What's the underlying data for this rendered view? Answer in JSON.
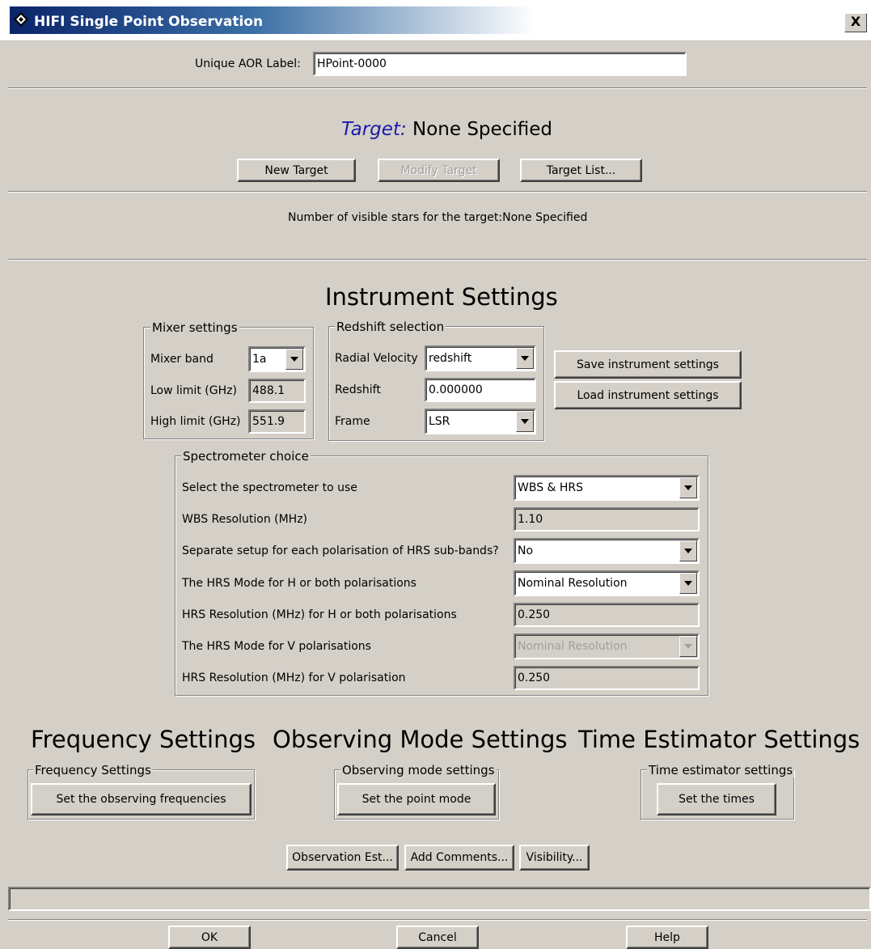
{
  "window": {
    "title": "HIFI Single Point Observation",
    "close_label": "X"
  },
  "aor": {
    "label": "Unique AOR Label:",
    "value": "HPoint-0000"
  },
  "target": {
    "prefix": "Target:",
    "value": "None Specified",
    "new_button": "New Target",
    "modify_button": "Modify Target",
    "list_button": "Target List...",
    "visible_stars": "Number of visible stars for the target:None Specified"
  },
  "instrument": {
    "heading": "Instrument Settings",
    "mixer": {
      "legend": "Mixer settings",
      "band_label": "Mixer band",
      "band_value": "1a",
      "low_label": "Low limit (GHz)",
      "low_value": "488.1",
      "high_label": "High limit (GHz)",
      "high_value": "551.9"
    },
    "redshift": {
      "legend": "Redshift selection",
      "velocity_label": "Radial Velocity",
      "velocity_value": "redshift",
      "redshift_label": "Redshift",
      "redshift_value": "0.000000",
      "frame_label": "Frame",
      "frame_value": "LSR"
    },
    "save_button": "Save instrument settings",
    "load_button": "Load instrument settings",
    "spectrometer": {
      "legend": "Spectrometer choice",
      "rows": [
        {
          "label": "Select the spectrometer to use",
          "value": "WBS & HRS"
        },
        {
          "label": "WBS Resolution (MHz)",
          "value": "1.10"
        },
        {
          "label": "Separate setup for each polarisation of HRS sub-bands?",
          "value": "No"
        },
        {
          "label": "The HRS Mode for H or both polarisations",
          "value": "Nominal Resolution"
        },
        {
          "label": "HRS Resolution (MHz) for H or both polarisations",
          "value": "0.250"
        },
        {
          "label": "The HRS Mode for V polarisations",
          "value": "Nominal Resolution"
        },
        {
          "label": "HRS Resolution (MHz) for V polarisation",
          "value": "0.250"
        }
      ]
    }
  },
  "frequency": {
    "heading": "Frequency Settings",
    "legend": "Frequency Settings",
    "button": "Set the observing frequencies"
  },
  "observing": {
    "heading": "Observing Mode Settings",
    "legend": "Observing mode settings",
    "button": "Set the point mode"
  },
  "time": {
    "heading": "Time Estimator Settings",
    "legend": "Time estimator settings",
    "button": "Set the times"
  },
  "bottom_buttons": {
    "observation": "Observation Est...",
    "comments": "Add Comments...",
    "visibility": "Visibility..."
  },
  "status": {
    "text": ""
  },
  "dialog": {
    "ok": "OK",
    "cancel": "Cancel",
    "help": "Help"
  },
  "colors": {
    "target_prefix": "#1a1aaa",
    "title_gradient_start": "#0a246a"
  }
}
